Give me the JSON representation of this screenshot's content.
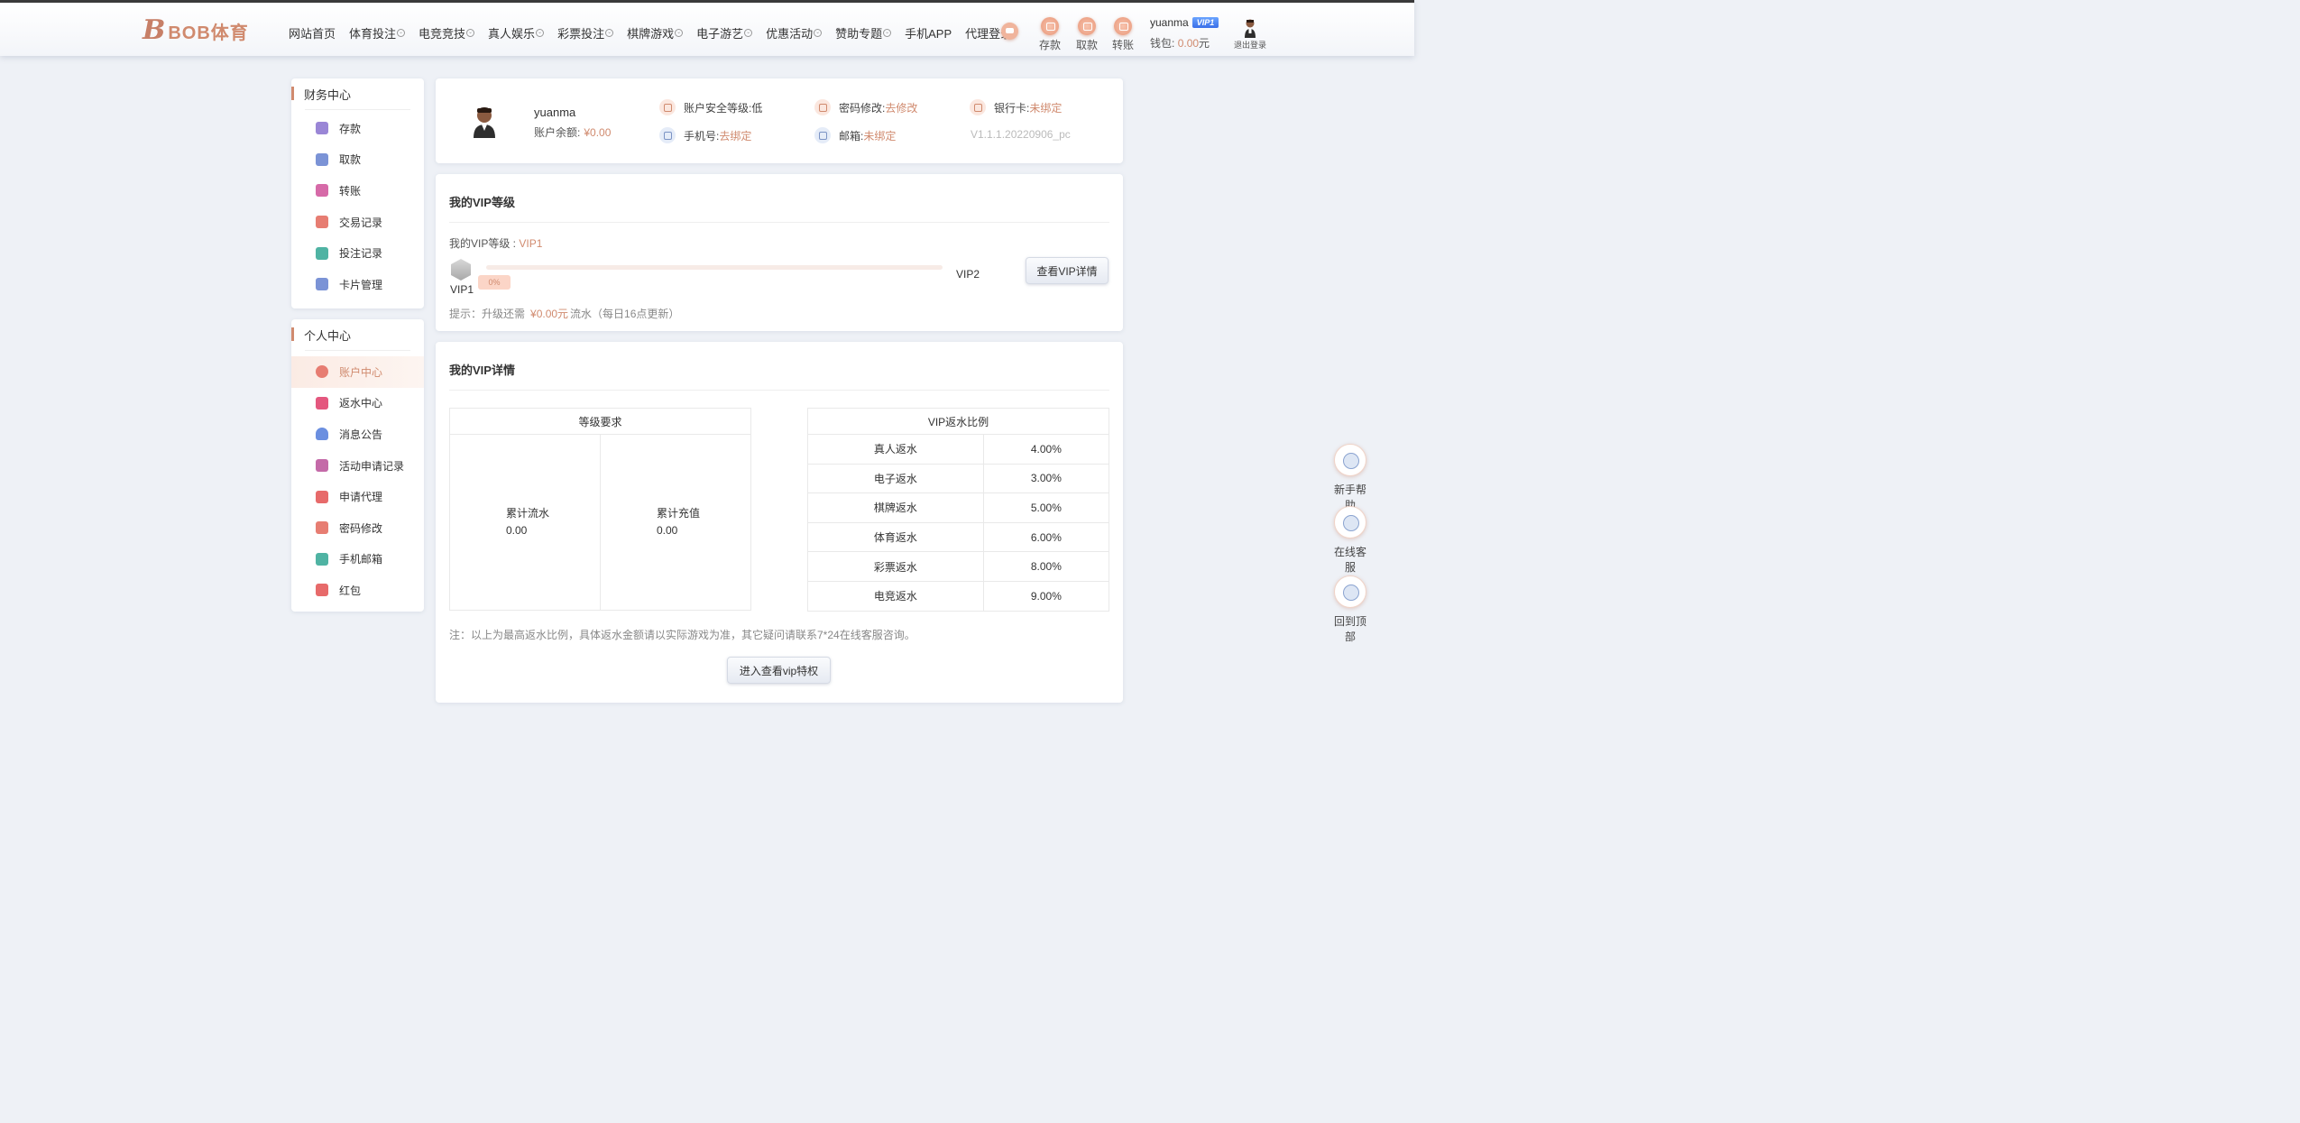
{
  "header": {
    "logo_mark": "B",
    "logo_text": "BOB体育",
    "nav": [
      {
        "label": "网站首页",
        "dropdown": false
      },
      {
        "label": "体育投注",
        "dropdown": true
      },
      {
        "label": "电竞竞技",
        "dropdown": true
      },
      {
        "label": "真人娱乐",
        "dropdown": true
      },
      {
        "label": "彩票投注",
        "dropdown": true
      },
      {
        "label": "棋牌游戏",
        "dropdown": true
      },
      {
        "label": "电子游艺",
        "dropdown": true
      },
      {
        "label": "优惠活动",
        "dropdown": true
      },
      {
        "label": "赞助专题",
        "dropdown": true
      },
      {
        "label": "手机APP",
        "dropdown": false
      },
      {
        "label": "代理登录",
        "dropdown": false
      }
    ],
    "quick": [
      {
        "label": "存款",
        "icon": "deposit-icon"
      },
      {
        "label": "取款",
        "icon": "withdraw-icon"
      },
      {
        "label": "转账",
        "icon": "transfer-icon"
      }
    ],
    "username": "yuanma",
    "vip_badge": "VIP1",
    "wallet_label": "钱包:",
    "wallet_amount": "0.00",
    "wallet_unit": "元",
    "logout_label": "退出登录"
  },
  "sidebar": {
    "finance": {
      "title": "财务中心",
      "items": [
        {
          "label": "存款",
          "color": "#9a86d6"
        },
        {
          "label": "取款",
          "color": "#7b93d6"
        },
        {
          "label": "转账",
          "color": "#d66aa8"
        },
        {
          "label": "交易记录",
          "color": "#e77d72"
        },
        {
          "label": "投注记录",
          "color": "#4fb3a3"
        },
        {
          "label": "卡片管理",
          "color": "#7b93d6"
        }
      ]
    },
    "personal": {
      "title": "个人中心",
      "items": [
        {
          "label": "账户中心",
          "color": "#e77d72",
          "active": true
        },
        {
          "label": "返水中心",
          "color": "#e4577e"
        },
        {
          "label": "消息公告",
          "color": "#6b8fe0"
        },
        {
          "label": "活动申请记录",
          "color": "#c46aa8"
        },
        {
          "label": "申请代理",
          "color": "#e76a6a"
        },
        {
          "label": "密码修改",
          "color": "#e77d72"
        },
        {
          "label": "手机邮箱",
          "color": "#4fb3a3"
        },
        {
          "label": "红包",
          "color": "#e76a6a"
        }
      ]
    }
  },
  "profile": {
    "username": "yuanma",
    "balance_label": "账户余额:",
    "balance": "¥0.00",
    "security_label": "账户安全等级:",
    "security_value": "低",
    "password_label": "密码修改:",
    "password_link": "去修改",
    "bank_label": "银行卡:",
    "bank_value": "未绑定",
    "phone_label": "手机号:",
    "phone_value": "去绑定",
    "email_label": "邮箱:",
    "email_value": "未绑定",
    "version": "V1.1.1.20220906_pc"
  },
  "vip_level": {
    "title": "我的VIP等级",
    "level_label": "我的VIP等级 :",
    "level_value": "VIP1",
    "current": "VIP1",
    "next": "VIP2",
    "progress": 0,
    "progress_text": "0%",
    "details_button": "查看VIP详情",
    "tip_prefix": "提示：升级还需",
    "tip_amount": "¥0.00元",
    "tip_suffix": "流水（每日16点更新）"
  },
  "vip_details": {
    "title": "我的VIP详情",
    "requirements_header": "等级要求",
    "requirements": [
      {
        "label": "累计流水",
        "value": "0.00"
      },
      {
        "label": "累计充值",
        "value": "0.00"
      }
    ],
    "rebate_header": "VIP返水比例",
    "rebates": [
      {
        "label": "真人返水",
        "value": "4.00%"
      },
      {
        "label": "电子返水",
        "value": "3.00%"
      },
      {
        "label": "棋牌返水",
        "value": "5.00%"
      },
      {
        "label": "体育返水",
        "value": "6.00%"
      },
      {
        "label": "彩票返水",
        "value": "8.00%"
      },
      {
        "label": "电竞返水",
        "value": "9.00%"
      }
    ],
    "note": "注：以上为最高返水比例，具体返水金额请以实际游戏为准，其它疑问请联系7*24在线客服咨询。",
    "privilege_button": "进入查看vip特权"
  },
  "float": [
    {
      "label": "新手帮助",
      "icon": "help-icon"
    },
    {
      "label": "在线客服",
      "icon": "support-icon"
    },
    {
      "label": "回到顶部",
      "icon": "back-to-top-icon"
    }
  ]
}
